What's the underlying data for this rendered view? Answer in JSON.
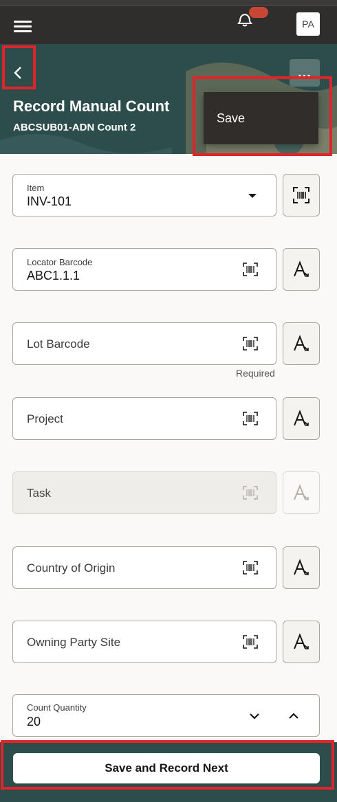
{
  "topbar": {
    "menu_icon": "hamburger-icon",
    "bell_icon": "bell-icon",
    "avatar_initials": "PA"
  },
  "header": {
    "back_icon": "chevron-left-icon",
    "more_label": "...",
    "title": "Record Manual Count",
    "subtitle": "ABCSUB01-ADN Count 2"
  },
  "menu": {
    "items": [
      {
        "label": "Save"
      }
    ]
  },
  "form": {
    "item": {
      "label": "Item",
      "value": "INV-101"
    },
    "locator": {
      "label": "Locator Barcode",
      "value": "ABC1.1.1"
    },
    "lot": {
      "label": "Lot Barcode",
      "helper": "Required"
    },
    "project": {
      "label": "Project"
    },
    "task": {
      "label": "Task"
    },
    "country": {
      "label": "Country of Origin"
    },
    "owning": {
      "label": "Owning Party Site"
    },
    "quantity": {
      "label": "Count Quantity",
      "value": "20"
    }
  },
  "footer": {
    "primary_label": "Save and Record Next"
  },
  "colors": {
    "header_teal": "#2c4d4c",
    "topbar": "#302e2c",
    "highlight": "#e0242a",
    "menu_bg": "#312d2a"
  }
}
